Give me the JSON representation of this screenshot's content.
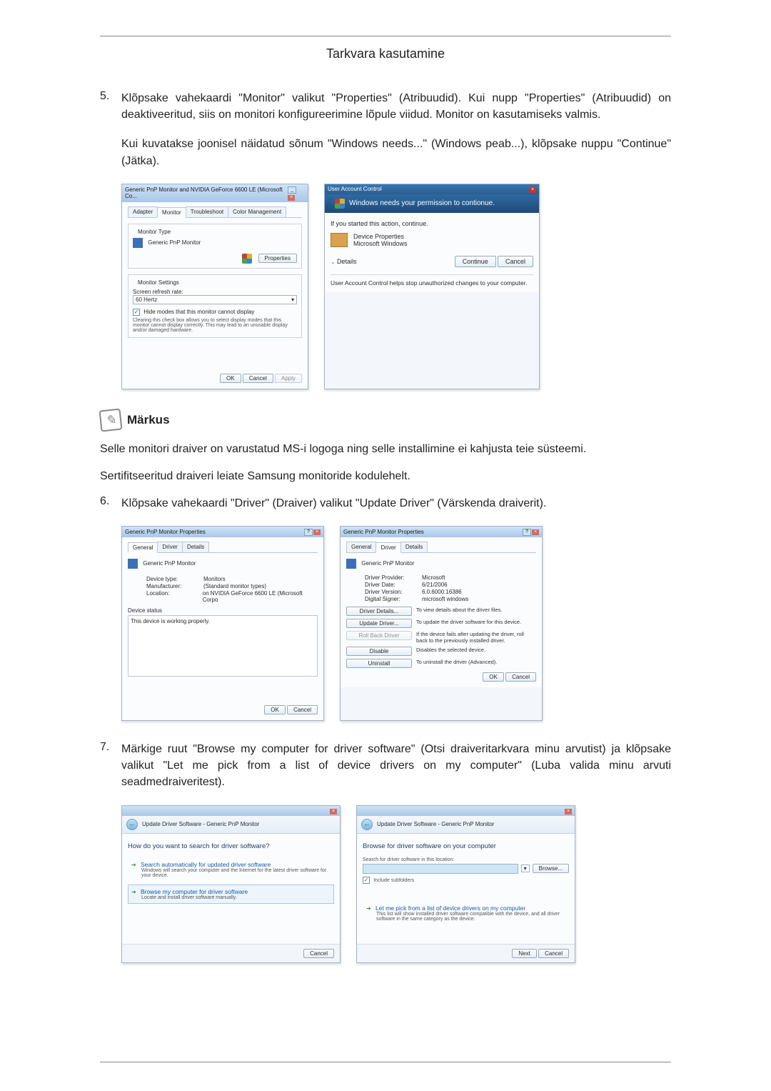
{
  "header": {
    "title": "Tarkvara kasutamine"
  },
  "steps": {
    "s5": {
      "num": "5.",
      "text": "Klõpsake vahekaardi \"Monitor\" valikut \"Properties\" (Atribuudid). Kui nupp \"Properties\" (Atribuudid) on deaktiveeritud, siis on monitori konfigureerimine lõpule viidud. Monitor on kasutamiseks valmis.",
      "sub": "Kui kuvatakse joonisel näidatud sõnum \"Windows needs...\" (Windows peab...), klõpsake nuppu \"Continue\" (Jätka)."
    },
    "s6": {
      "num": "6.",
      "text": "Klõpsake vahekaardi \"Driver\" (Draiver) valikut \"Update Driver\" (Värskenda draiverit)."
    },
    "s7": {
      "num": "7.",
      "text": "Märkige ruut \"Browse my computer for driver software\" (Otsi draiveritarkvara minu arvutist) ja klõpsake valikut \"Let me pick from a list of device drivers on my computer\" (Luba valida minu arvuti seadmedraiveritest)."
    }
  },
  "note": {
    "label": "Märkus",
    "p1": "Selle monitori draiver on varustatud MS-i logoga ning selle installimine ei kahjusta teie süsteemi.",
    "p2": "Sertifitseeritud draiveri leiate Samsung monitoride kodulehelt."
  },
  "fig_monitor": {
    "title": "Generic PnP Monitor and NVIDIA GeForce 6600 LE (Microsoft Co...",
    "tabs": {
      "adapter": "Adapter",
      "monitor": "Monitor",
      "troubleshoot": "Troubleshoot",
      "color": "Color Management"
    },
    "monitor_type_label": "Monitor Type",
    "monitor_name": "Generic PnP Monitor",
    "properties_btn": "Properties",
    "settings_label": "Monitor Settings",
    "refresh_label": "Screen refresh rate:",
    "refresh_value": "60 Hertz",
    "hide_modes": "Hide modes that this monitor cannot display",
    "hide_desc": "Clearing this check box allows you to select display modes that this monitor cannot display correctly. This may lead to an unusable display and/or damaged hardware.",
    "ok": "OK",
    "cancel": "Cancel",
    "apply": "Apply"
  },
  "fig_uac": {
    "title": "User Account Control",
    "banner": "Windows needs your permission to contionue.",
    "sub": "If you started this action, continue.",
    "prog": "Device Properties",
    "publisher": "Microsoft Windows",
    "details": "Details",
    "continue": "Continue",
    "cancel": "Cancel",
    "footer": "User Account Control helps stop unauthorized changes to your computer."
  },
  "fig_props_general": {
    "title": "Generic PnP Monitor Properties",
    "tabs": {
      "general": "General",
      "driver": "Driver",
      "details": "Details"
    },
    "name": "Generic PnP Monitor",
    "device_type_l": "Device type:",
    "device_type_v": "Monitors",
    "manufacturer_l": "Manufacturer:",
    "manufacturer_v": "(Standard monitor types)",
    "location_l": "Location:",
    "location_v": "on NVIDIA GeForce 6600 LE (Microsoft Corpo",
    "status_label": "Device status",
    "status_text": "This device is working properly.",
    "ok": "OK",
    "cancel": "Cancel"
  },
  "fig_props_driver": {
    "title": "Generic PnP Monitor Properties",
    "tabs": {
      "general": "General",
      "driver": "Driver",
      "details": "Details"
    },
    "name": "Generic PnP Monitor",
    "provider_l": "Driver Provider:",
    "provider_v": "Microsoft",
    "date_l": "Driver Date:",
    "date_v": "6/21/2006",
    "version_l": "Driver Version:",
    "version_v": "6.0.6000.16386",
    "signer_l": "Digital Signer:",
    "signer_v": "microsoft windows",
    "details_btn": "Driver Details...",
    "details_desc": "To view details about the driver files.",
    "update_btn": "Update Driver...",
    "update_desc": "To update the driver software for this device.",
    "rollback_btn": "Roll Back Driver",
    "rollback_desc": "If the device fails after updating the driver, roll back to the previously installed driver.",
    "disable_btn": "Disable",
    "disable_desc": "Disables the selected device.",
    "uninstall_btn": "Uninstall",
    "uninstall_desc": "To uninstall the driver (Advanced).",
    "ok": "OK",
    "cancel": "Cancel"
  },
  "fig_wiz_a": {
    "breadcrumb": "Update Driver Software - Generic PnP Monitor",
    "heading": "How do you want to search for driver software?",
    "opt1_title": "Search automatically for updated driver software",
    "opt1_desc": "Windows will search your computer and the Internet for the latest driver software for your device.",
    "opt2_title": "Browse my computer for driver software",
    "opt2_desc": "Locate and install driver software manually.",
    "cancel": "Cancel"
  },
  "fig_wiz_b": {
    "breadcrumb": "Update Driver Software - Generic PnP Monitor",
    "heading": "Browse for driver software on your computer",
    "loc_label": "Search for driver software in this location:",
    "path_value": "",
    "browse": "Browse...",
    "include": "Include subfolders",
    "opt_title": "Let me pick from a list of device drivers on my computer",
    "opt_desc": "This list will show installed driver software compatible with the device, and all driver software in the same category as the device.",
    "next": "Next",
    "cancel": "Cancel"
  }
}
